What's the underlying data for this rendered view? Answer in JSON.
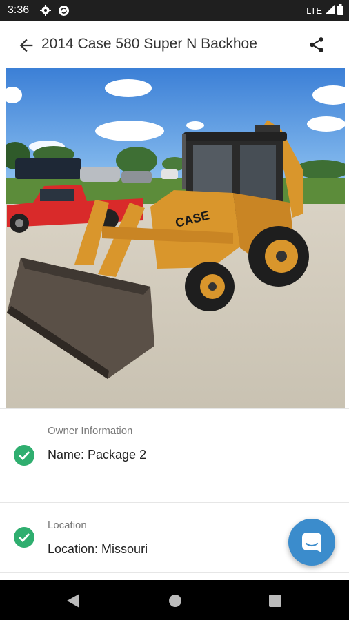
{
  "status_bar": {
    "time": "3:36",
    "network": "LTE",
    "icons": [
      "settings-icon",
      "sync-icon",
      "signal-icon",
      "battery-icon"
    ]
  },
  "app_bar": {
    "title": "2014 Case 580 Super N Backhoe",
    "back_icon": "arrow-left-icon",
    "share_icon": "share-icon"
  },
  "hero_image": {
    "subject": "backhoe-photo",
    "machine_badge": "CASE"
  },
  "owner_card": {
    "label": "Owner Information",
    "value": "Name:  Package 2",
    "status_icon": "check-circle-icon"
  },
  "location_card": {
    "label": "Location",
    "value": "Location:  Missouri",
    "status_icon": "check-circle-icon"
  },
  "fab": {
    "icon": "chat-icon"
  },
  "nav_bar": {
    "icons": [
      "back-triangle-icon",
      "home-circle-icon",
      "recents-square-icon"
    ]
  },
  "colors": {
    "status_bar": "#1f1f1f",
    "check_green": "#2fae6f",
    "fab_blue": "#3b8ccc",
    "machine_yellow": "#d9962c"
  }
}
